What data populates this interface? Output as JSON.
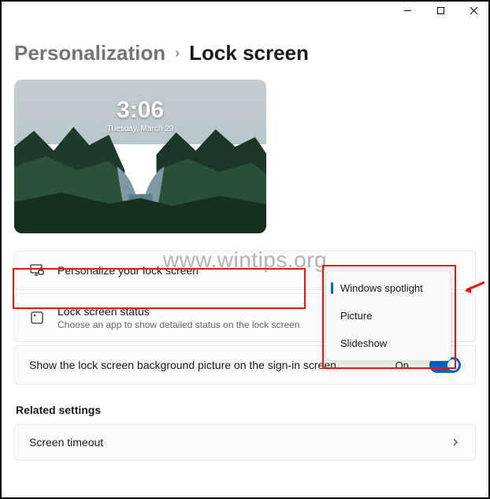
{
  "window": {
    "minimize": "minimize",
    "maximize": "maximize",
    "close": "close"
  },
  "breadcrumb": {
    "parent": "Personalization",
    "sep": "›",
    "current": "Lock screen"
  },
  "preview": {
    "time": "3:06",
    "date": "Tuesday, March 29"
  },
  "rows": {
    "personalize": {
      "title": "Personalize your lock screen"
    },
    "status": {
      "title": "Lock screen status",
      "sub": "Choose an app to show detailed status on the lock screen"
    },
    "signin": {
      "title": "Show the lock screen background picture on the sign-in screen",
      "state": "On"
    },
    "timeout": {
      "title": "Screen timeout"
    }
  },
  "dropdown": {
    "items": [
      {
        "label": "Windows spotlight",
        "selected": true
      },
      {
        "label": "Picture",
        "selected": false
      },
      {
        "label": "Slideshow",
        "selected": false
      }
    ]
  },
  "section": {
    "related": "Related settings"
  },
  "watermark": "www.wintips.org"
}
